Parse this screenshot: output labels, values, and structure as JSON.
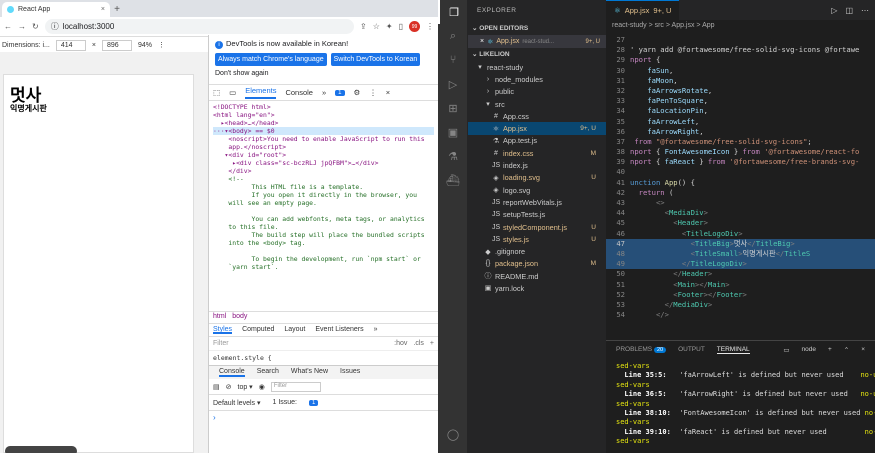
{
  "browser": {
    "tab_title": "React App",
    "tab_close": "×",
    "new_tab": "+",
    "url": "localhost:3000",
    "avatar": "99",
    "device": {
      "label": "Dimensions: i...",
      "width": "414",
      "height": "896",
      "zoom": "94%"
    },
    "page": {
      "title_big": "멋사",
      "title_small": "익명게시판"
    }
  },
  "devtools": {
    "notice": "DevTools is now available in Korean!",
    "btn_match": "Always match Chrome's language",
    "btn_switch": "Switch DevTools to Korean",
    "dont_show": "Don't show again",
    "tabs": [
      "Elements",
      "Console",
      "»"
    ],
    "issues_count": "1",
    "elements_lines": [
      {
        "t": "<!DOCTYPE html>",
        "c": ""
      },
      {
        "t": "<html lang=\"en\">",
        "c": ""
      },
      {
        "t": "  ▸<head>…</head>",
        "c": ""
      },
      {
        "t": "···▾<body> == $0",
        "c": "sel"
      },
      {
        "t": "    <noscript>You need to enable JavaScript to run this",
        "c": ""
      },
      {
        "t": "    app.</noscript>",
        "c": ""
      },
      {
        "t": "   ▾<div id=\"root\">",
        "c": ""
      },
      {
        "t": "     ▸<div class=\"sc-bczRLJ jpQFBM\">…</div>",
        "c": ""
      },
      {
        "t": "    </div>",
        "c": ""
      },
      {
        "t": "    <!--",
        "c": "com"
      },
      {
        "t": "          This HTML file is a template.",
        "c": "com"
      },
      {
        "t": "          If you open it directly in the browser, you",
        "c": "com"
      },
      {
        "t": "    will see an empty page.",
        "c": "com"
      },
      {
        "t": "",
        "c": "com"
      },
      {
        "t": "          You can add webfonts, meta tags, or analytics",
        "c": "com"
      },
      {
        "t": "    to this file.",
        "c": "com"
      },
      {
        "t": "          The build step will place the bundled scripts",
        "c": "com"
      },
      {
        "t": "    into the <body> tag.",
        "c": "com"
      },
      {
        "t": "",
        "c": "com"
      },
      {
        "t": "          To begin the development, run `npm start` or",
        "c": "com"
      },
      {
        "t": "    `yarn start`.",
        "c": "com"
      }
    ],
    "crumbs": [
      "html",
      "body"
    ],
    "style_tabs": [
      "Styles",
      "Computed",
      "Layout",
      "Event Listeners",
      "»"
    ],
    "filter": "Filter",
    "filter_tools": [
      ":hov",
      ".cls",
      "+"
    ],
    "element_style": "element.style {",
    "console_tabs": [
      "Console",
      "Search",
      "What's New",
      "Issues"
    ],
    "console_top": "top ▾",
    "console_filter": "Filter",
    "levels": "Default levels ▾",
    "issue": "1 Issue:",
    "issue_count": "1",
    "prompt": "›"
  },
  "vscode": {
    "explorer": "EXPLORER",
    "open_editors": "OPEN EDITORS",
    "open_file": "App.jsx",
    "open_file_path": "react-stud...",
    "open_file_status": "9+, U",
    "project": "LIKELION",
    "tree": [
      {
        "name": "react-study",
        "indent": 1,
        "icon": "▾",
        "m": ""
      },
      {
        "name": "node_modules",
        "indent": 2,
        "icon": "›",
        "m": ""
      },
      {
        "name": "public",
        "indent": 2,
        "icon": "›",
        "m": ""
      },
      {
        "name": "src",
        "indent": 2,
        "icon": "▾",
        "m": ""
      },
      {
        "name": "App.css",
        "indent": 3,
        "icon": "#",
        "m": ""
      },
      {
        "name": "App.jsx",
        "indent": 3,
        "icon": "⚛",
        "m": "9+, U",
        "sel": true
      },
      {
        "name": "App.test.js",
        "indent": 3,
        "icon": "⚗",
        "m": ""
      },
      {
        "name": "index.css",
        "indent": 3,
        "icon": "#",
        "m": "M"
      },
      {
        "name": "index.js",
        "indent": 3,
        "icon": "JS",
        "m": ""
      },
      {
        "name": "loading.svg",
        "indent": 3,
        "icon": "◈",
        "m": "U"
      },
      {
        "name": "logo.svg",
        "indent": 3,
        "icon": "◈",
        "m": ""
      },
      {
        "name": "reportWebVitals.js",
        "indent": 3,
        "icon": "JS",
        "m": ""
      },
      {
        "name": "setupTests.js",
        "indent": 3,
        "icon": "JS",
        "m": ""
      },
      {
        "name": "styledComponent.js",
        "indent": 3,
        "icon": "JS",
        "m": "U"
      },
      {
        "name": "styles.js",
        "indent": 3,
        "icon": "JS",
        "m": "U"
      },
      {
        "name": ".gitignore",
        "indent": 2,
        "icon": "◆",
        "m": ""
      },
      {
        "name": "package.json",
        "indent": 2,
        "icon": "{}",
        "m": "M"
      },
      {
        "name": "README.md",
        "indent": 2,
        "icon": "ⓘ",
        "m": ""
      },
      {
        "name": "yarn.lock",
        "indent": 2,
        "icon": "▣",
        "m": ""
      }
    ],
    "editor_tab": "App.jsx",
    "editor_tab_status": "9+, U",
    "breadcrumb": "react-study > src > App.jsx > App",
    "code": [
      {
        "n": "27",
        "h": [
          [
            "pun",
            ""
          ]
        ]
      },
      {
        "n": "28",
        "h": [
          [
            "txt",
            "' yarn add @fortawesome/free-solid-svg-icons @fortawe"
          ]
        ]
      },
      {
        "n": "29",
        "h": [
          [
            "kw",
            "nport"
          ],
          [
            "txt",
            " {"
          ]
        ]
      },
      {
        "n": "30",
        "h": [
          [
            "id",
            "    faSun"
          ],
          [
            "txt",
            ","
          ]
        ]
      },
      {
        "n": "31",
        "h": [
          [
            "id",
            "    faMoon"
          ],
          [
            "txt",
            ","
          ]
        ]
      },
      {
        "n": "32",
        "h": [
          [
            "id",
            "    faArrowsRotate"
          ],
          [
            "txt",
            ","
          ]
        ]
      },
      {
        "n": "33",
        "h": [
          [
            "id",
            "    faPenToSquare"
          ],
          [
            "txt",
            ","
          ]
        ]
      },
      {
        "n": "34",
        "h": [
          [
            "id",
            "    faLocationPin"
          ],
          [
            "txt",
            ","
          ]
        ]
      },
      {
        "n": "35",
        "h": [
          [
            "id",
            "    faArrowLeft"
          ],
          [
            "txt",
            ","
          ]
        ]
      },
      {
        "n": "36",
        "h": [
          [
            "id",
            "    faArrowRight"
          ],
          [
            "txt",
            ","
          ]
        ]
      },
      {
        "n": "37",
        "h": [
          [
            "txt",
            " "
          ],
          [
            "kw",
            "from"
          ],
          [
            "str",
            " \"@fortawesome/free-solid-svg-icons\""
          ],
          [
            "txt",
            ";"
          ]
        ]
      },
      {
        "n": "38",
        "h": [
          [
            "kw",
            "nport"
          ],
          [
            "txt",
            " { "
          ],
          [
            "id",
            "FontAwesomeIcon"
          ],
          [
            "txt",
            " } "
          ],
          [
            "kw",
            "from"
          ],
          [
            "str",
            " '@fortawesome/react-fo"
          ]
        ]
      },
      {
        "n": "39",
        "h": [
          [
            "kw",
            "nport"
          ],
          [
            "txt",
            " { "
          ],
          [
            "id",
            "faReact"
          ],
          [
            "txt",
            " } "
          ],
          [
            "kw",
            "from"
          ],
          [
            "str",
            " '@fortawesome/free-brands-svg-"
          ]
        ]
      },
      {
        "n": "40",
        "h": [
          [
            "txt",
            ""
          ]
        ]
      },
      {
        "n": "41",
        "h": [
          [
            "kw2",
            "unction"
          ],
          [
            "txt",
            " "
          ],
          [
            "fn",
            "App"
          ],
          [
            "txt",
            "() {"
          ]
        ]
      },
      {
        "n": "42",
        "h": [
          [
            "kw",
            "  return"
          ],
          [
            "txt",
            " ("
          ]
        ]
      },
      {
        "n": "43",
        "h": [
          [
            "pun",
            "      <>"
          ]
        ]
      },
      {
        "n": "44",
        "h": [
          [
            "pun",
            "        <"
          ],
          [
            "tag",
            "MediaDiv"
          ],
          [
            "pun",
            ">"
          ]
        ]
      },
      {
        "n": "45",
        "h": [
          [
            "pun",
            "          <"
          ],
          [
            "tag",
            "Header"
          ],
          [
            "pun",
            ">"
          ]
        ]
      },
      {
        "n": "46",
        "h": [
          [
            "pun",
            "            <"
          ],
          [
            "tag",
            "TitleLogoDiv"
          ],
          [
            "pun",
            ">"
          ]
        ]
      },
      {
        "n": "47",
        "h": [
          [
            "pun",
            "              <"
          ],
          [
            "tag",
            "TitleBig"
          ],
          [
            "pun",
            ">"
          ],
          [
            "txt",
            "멋사"
          ],
          [
            "pun",
            "</"
          ],
          [
            "tag",
            "TitleBig"
          ],
          [
            "pun",
            ">"
          ]
        ],
        "cur": true,
        "hl": true
      },
      {
        "n": "48",
        "h": [
          [
            "pun",
            "              <"
          ],
          [
            "tag",
            "TitleSmall"
          ],
          [
            "pun",
            ">"
          ],
          [
            "txt",
            "익명게시판"
          ],
          [
            "pun",
            "</"
          ],
          [
            "tag",
            "TitleS"
          ]
        ],
        "hl": true
      },
      {
        "n": "49",
        "h": [
          [
            "pun",
            "            </"
          ],
          [
            "tag",
            "TitleLogoDiv"
          ],
          [
            "pun",
            ">"
          ]
        ],
        "hl": true
      },
      {
        "n": "50",
        "h": [
          [
            "pun",
            "          </"
          ],
          [
            "tag",
            "Header"
          ],
          [
            "pun",
            ">"
          ]
        ]
      },
      {
        "n": "51",
        "h": [
          [
            "pun",
            "          <"
          ],
          [
            "tag",
            "Main"
          ],
          [
            "pun",
            "></"
          ],
          [
            "tag",
            "Main"
          ],
          [
            "pun",
            ">"
          ]
        ]
      },
      {
        "n": "52",
        "h": [
          [
            "pun",
            "          <"
          ],
          [
            "tag",
            "Footer"
          ],
          [
            "pun",
            "></"
          ],
          [
            "tag",
            "Footer"
          ],
          [
            "pun",
            ">"
          ]
        ]
      },
      {
        "n": "53",
        "h": [
          [
            "pun",
            "        </"
          ],
          [
            "tag",
            "MediaDiv"
          ],
          [
            "pun",
            ">"
          ]
        ]
      },
      {
        "n": "54",
        "h": [
          [
            "pun",
            "      </>"
          ]
        ]
      }
    ],
    "panel_tabs": [
      "PROBLEMS",
      "OUTPUT",
      "TERMINAL"
    ],
    "problems_count": "20",
    "terminal_name": "node",
    "terminal": [
      {
        "k": "yel",
        "t": "sed-vars"
      },
      {
        "k": "line",
        "loc": "  Line 35:5:",
        "msg": "   'faArrowLeft' is defined but never used",
        "tail": "    no-u"
      },
      {
        "k": "yel",
        "t": "sed-vars"
      },
      {
        "k": "line",
        "loc": "  Line 36:5:",
        "msg": "   'faArrowRight' is defined but never used",
        "tail": "   no-u"
      },
      {
        "k": "yel",
        "t": "sed-vars"
      },
      {
        "k": "line",
        "loc": "  Line 38:10:",
        "msg": "  'FontAwesomeIcon' is defined but never used",
        "tail": " no-u"
      },
      {
        "k": "yel",
        "t": "sed-vars"
      },
      {
        "k": "line",
        "loc": "  Line 39:10:",
        "msg": "  'faReact' is defined but never used",
        "tail": "         no-u"
      },
      {
        "k": "yel",
        "t": "sed-vars"
      }
    ]
  },
  "colors": {
    "vscode_bg": "#1e1e1e",
    "accent": "#1a73e8",
    "selection": "#264f78"
  }
}
